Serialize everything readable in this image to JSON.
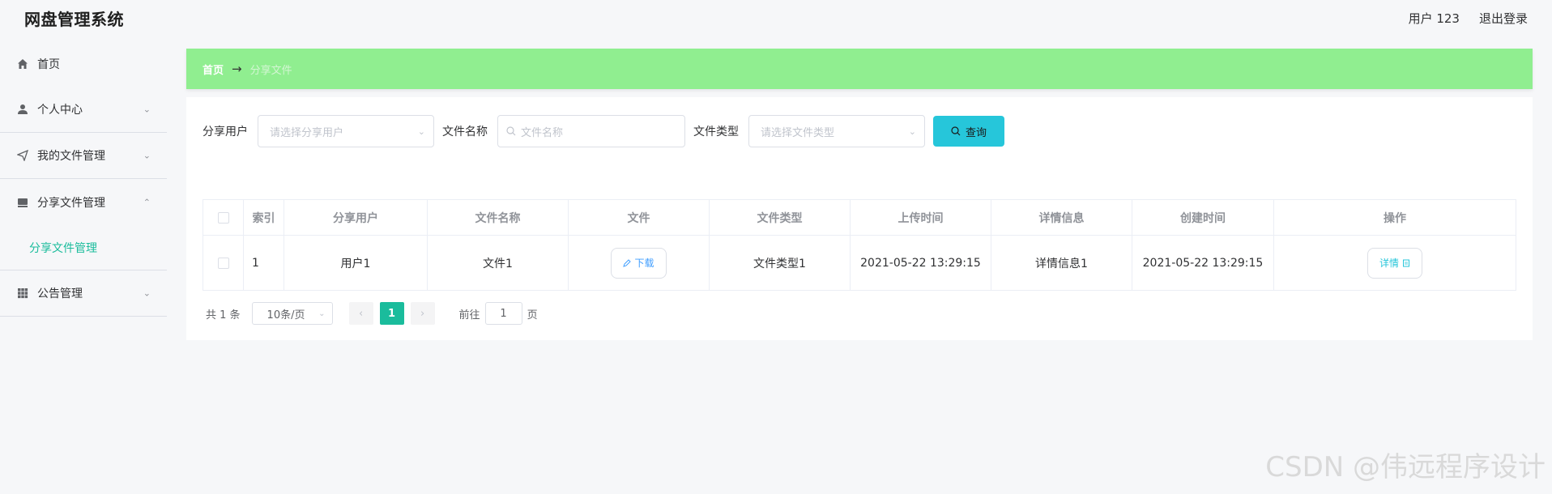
{
  "header": {
    "app_title": "网盘管理系统",
    "user_label": "用户 123",
    "logout_label": "退出登录"
  },
  "sidebar": {
    "items": [
      {
        "label": "首页",
        "icon": "home-icon"
      },
      {
        "label": "个人中心",
        "icon": "user-icon",
        "expanded": false
      },
      {
        "label": "我的文件管理",
        "icon": "send-icon",
        "expanded": false
      },
      {
        "label": "分享文件管理",
        "icon": "drive-icon",
        "expanded": true
      },
      {
        "label": "公告管理",
        "icon": "grid-icon",
        "expanded": false
      }
    ],
    "active_subitem": "分享文件管理"
  },
  "breadcrumb": {
    "home": "首页",
    "separator": "→",
    "current": "分享文件"
  },
  "search": {
    "share_user_label": "分享用户",
    "share_user_placeholder": "请选择分享用户",
    "file_name_label": "文件名称",
    "file_name_placeholder": "文件名称",
    "file_type_label": "文件类型",
    "file_type_placeholder": "请选择文件类型",
    "query_button": "查询"
  },
  "table": {
    "headers": [
      "索引",
      "分享用户",
      "文件名称",
      "文件",
      "文件类型",
      "上传时间",
      "详情信息",
      "创建时间",
      "操作"
    ],
    "rows": [
      {
        "index": "1",
        "share_user": "用户1",
        "file_name": "文件1",
        "download_label": "下载",
        "file_type": "文件类型1",
        "upload_time": "2021-05-22 13:29:15",
        "detail_info": "详情信息1",
        "create_time": "2021-05-22 13:29:15",
        "action_label": "详情"
      }
    ]
  },
  "pagination": {
    "total_label": "共 1 条",
    "page_size": "10条/页",
    "current_page": "1",
    "goto_label": "前往",
    "goto_value": "1",
    "page_suffix": "页"
  },
  "watermark": "CSDN @伟远程序设计",
  "colors": {
    "breadcrumb_bg": "#90ee90",
    "accent": "#1abc9c",
    "query_button": "#26c6da"
  }
}
